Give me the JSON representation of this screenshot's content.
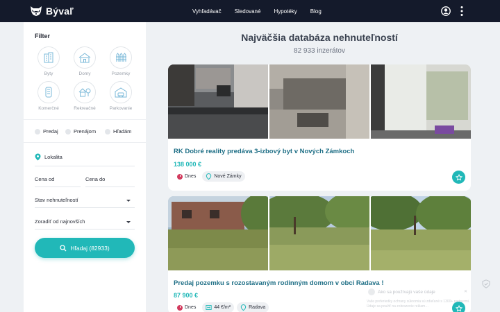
{
  "header": {
    "brand": "Bývaľ",
    "nav": [
      "Vyhľadávač",
      "Sledované",
      "Hypotéky",
      "Blog"
    ],
    "icons": [
      "raccoon-logo-icon",
      "user-account-icon",
      "more-vertical-icon"
    ]
  },
  "sidebar": {
    "title": "Filter",
    "categories": [
      {
        "label": "Byty",
        "icon": "apartment-icon"
      },
      {
        "label": "Domy",
        "icon": "house-icon"
      },
      {
        "label": "Pozemky",
        "icon": "land-fence-icon"
      },
      {
        "label": "Komerčné",
        "icon": "commercial-building-icon"
      },
      {
        "label": "Rekreačné",
        "icon": "cottage-tree-icon"
      },
      {
        "label": "Parkovanie",
        "icon": "garage-icon"
      }
    ],
    "offer_types": [
      "Predaj",
      "Prenájom",
      "Hľadám"
    ],
    "location_placeholder": "Lokalita",
    "price_from": "Cena od",
    "price_to": "Cena do",
    "condition_select": "Stav nehnuteľností",
    "sort_select": "Zoradiť od najnovších",
    "search_button": "Hľadaj (82933)"
  },
  "main": {
    "title": "Najväčšia databáza nehnuteľností",
    "count": "82 933 inzerátov",
    "listings": [
      {
        "title": "RK Dobré reality predáva 3-izbový byt v Nových Zámkoch",
        "price": "138 000 €",
        "date": "Dnes",
        "location": "Nové Zámky",
        "area_price": ""
      },
      {
        "title": "Predaj pozemku s rozostavaným rodinným domom v obci Radava !",
        "price": "87 900 €",
        "date": "Dnes",
        "area_price": "44 €/m²",
        "location": "Radava"
      }
    ]
  },
  "privacy": {
    "title": "Ako sa používajú vaše údaje",
    "text": "Vaše preferiedky ochrany súkromia sú zdieľané s 1300+ partnermi. Údaje sa použiť na zobrazenie reklam…"
  },
  "colors": {
    "header_bg": "#141a2b",
    "accent": "#21b8b8",
    "title_link": "#1f6f86",
    "badge_red": "#d23b5e",
    "page_bg": "#eef1f4"
  }
}
